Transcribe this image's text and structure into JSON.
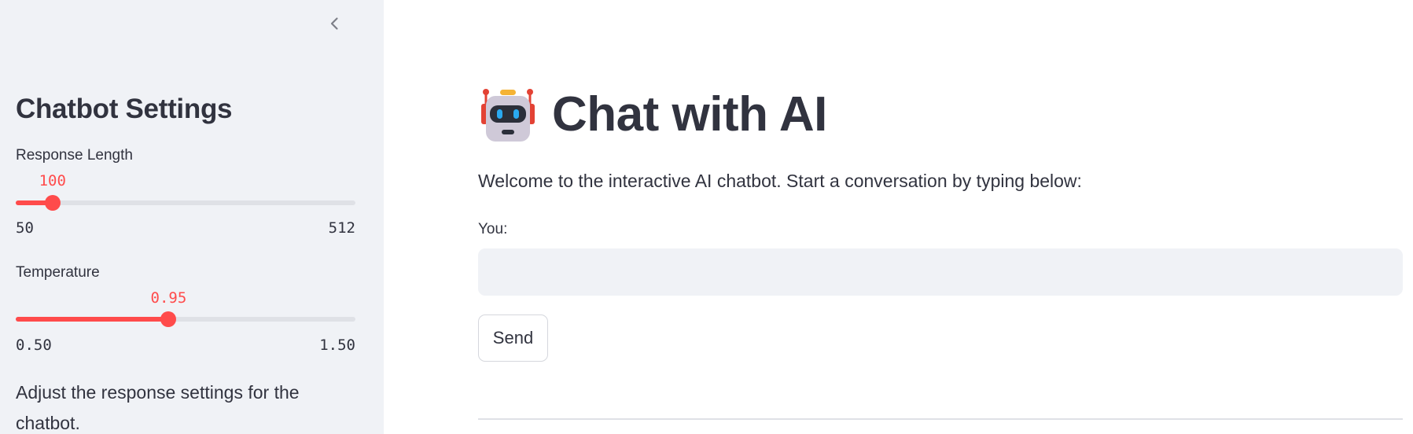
{
  "sidebar": {
    "title": "Chatbot Settings",
    "collapse_icon": "chevron-left-icon",
    "sliders": {
      "response_length": {
        "label": "Response Length",
        "value": "100",
        "min": "50",
        "max": "512",
        "value_num": 100,
        "min_num": 50,
        "max_num": 512
      },
      "temperature": {
        "label": "Temperature",
        "value": "0.95",
        "min": "0.50",
        "max": "1.50",
        "value_num": 0.95,
        "min_num": 0.5,
        "max_num": 1.5
      }
    },
    "note": "Adjust the response settings for the chatbot."
  },
  "main": {
    "title_icon": "robot-icon",
    "title": "Chat with AI",
    "welcome": "Welcome to the interactive AI chatbot. Start a conversation by typing below:",
    "input_label": "You:",
    "input_value": "",
    "send_label": "Send"
  },
  "colors": {
    "accent": "#ff4b4b",
    "sidebar_bg": "#f0f2f6",
    "text": "#31333f"
  }
}
